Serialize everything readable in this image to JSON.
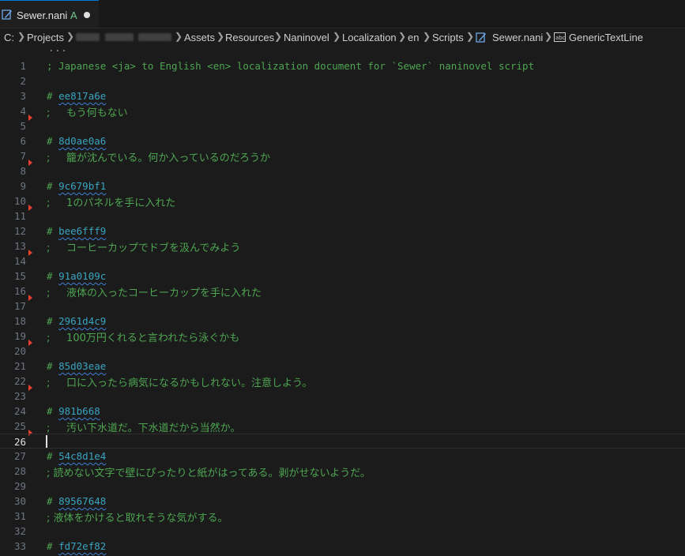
{
  "tab": {
    "filename": "Sewer.nani",
    "status": "A",
    "dirty_icon": "dirty-dot-icon"
  },
  "breadcrumb": {
    "items": [
      "C:",
      "Projects",
      "Assets",
      "Resources",
      "Naninovel",
      "Localization",
      "en",
      "Scripts",
      "Sewer.nani",
      "GenericTextLine"
    ]
  },
  "editor": {
    "folded": "...",
    "current_line": 26,
    "lines": [
      {
        "n": "1",
        "text": "; Japanese <ja> to English <en> localization document for `Sewer` naninovel script"
      },
      {
        "n": "2",
        "text": ""
      },
      {
        "n": "3",
        "hash": "# ",
        "id": "ee817a6e"
      },
      {
        "n": "4",
        "text": ";     もう何もない"
      },
      {
        "n": "5",
        "text": ""
      },
      {
        "n": "6",
        "hash": "# ",
        "id": "8d0ae0a6"
      },
      {
        "n": "7",
        "text": ";     籠が沈んでいる。何か入っているのだろうか"
      },
      {
        "n": "8",
        "text": ""
      },
      {
        "n": "9",
        "hash": "# ",
        "id": "9c679bf1"
      },
      {
        "n": "10",
        "text": ";     1のパネルを手に入れた"
      },
      {
        "n": "11",
        "text": ""
      },
      {
        "n": "12",
        "hash": "# ",
        "id": "bee6fff9"
      },
      {
        "n": "13",
        "text": ";     コーヒーカップでドブを汲んでみよう"
      },
      {
        "n": "14",
        "text": ""
      },
      {
        "n": "15",
        "hash": "# ",
        "id": "91a0109c"
      },
      {
        "n": "16",
        "text": ";     液体の入ったコーヒーカップを手に入れた"
      },
      {
        "n": "17",
        "text": ""
      },
      {
        "n": "18",
        "hash": "# ",
        "id": "2961d4c9"
      },
      {
        "n": "19",
        "text": ";     100万円くれると言われたら泳ぐかも"
      },
      {
        "n": "20",
        "text": ""
      },
      {
        "n": "21",
        "hash": "# ",
        "id": "85d03eae"
      },
      {
        "n": "22",
        "text": ";     口に入ったら病気になるかもしれない。注意しよう。"
      },
      {
        "n": "23",
        "text": ""
      },
      {
        "n": "24",
        "hash": "# ",
        "id": "981b668"
      },
      {
        "n": "25",
        "text": ";     汚い下水道だ。下水道だから当然か。"
      },
      {
        "n": "26",
        "text": ""
      },
      {
        "n": "27",
        "hash": "# ",
        "id": "54c8d1e4"
      },
      {
        "n": "28",
        "text": "; 読めない文字で壁にぴったりと紙がはってある。剥がせないようだ。"
      },
      {
        "n": "29",
        "text": ""
      },
      {
        "n": "30",
        "hash": "# ",
        "id": "89567648"
      },
      {
        "n": "31",
        "text": "; 液体をかけると取れそうな気がする。"
      },
      {
        "n": "32",
        "text": ""
      },
      {
        "n": "33",
        "hash": "# ",
        "id": "fd72ef82"
      }
    ]
  }
}
